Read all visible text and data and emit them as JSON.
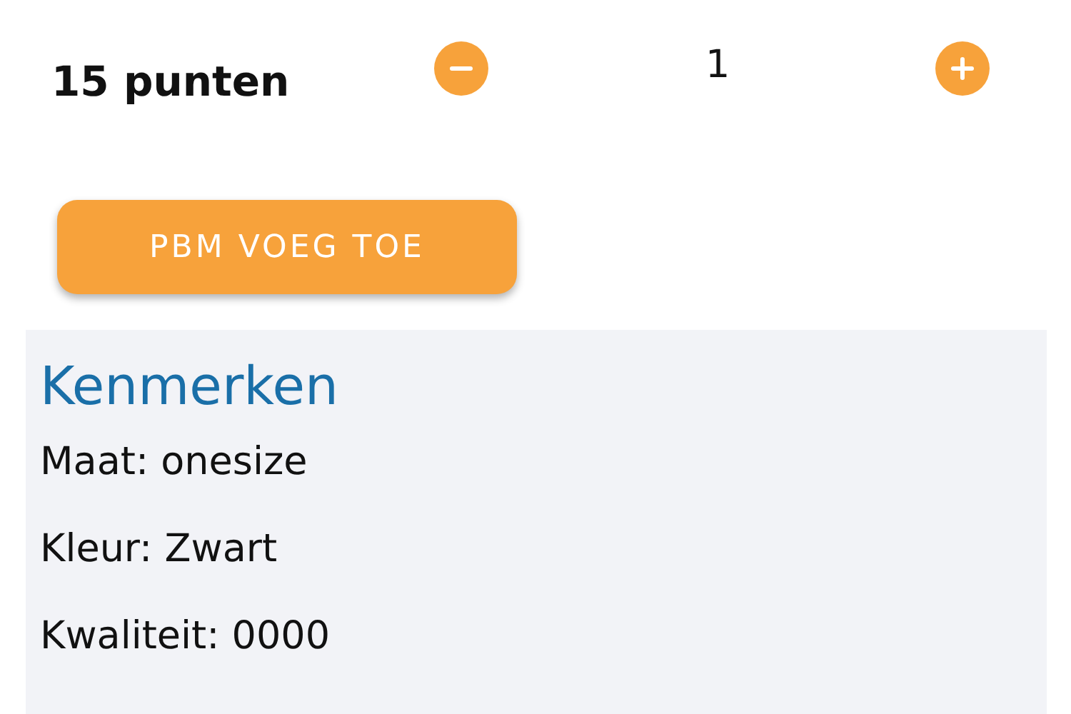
{
  "points": "15 punten",
  "quantity": {
    "value": "1"
  },
  "add_button": "PBM VOEG TOE",
  "features": {
    "title": "Kenmerken",
    "items": [
      "Maat: onesize",
      "Kleur: Zwart",
      "Kwaliteit: 0000"
    ]
  }
}
